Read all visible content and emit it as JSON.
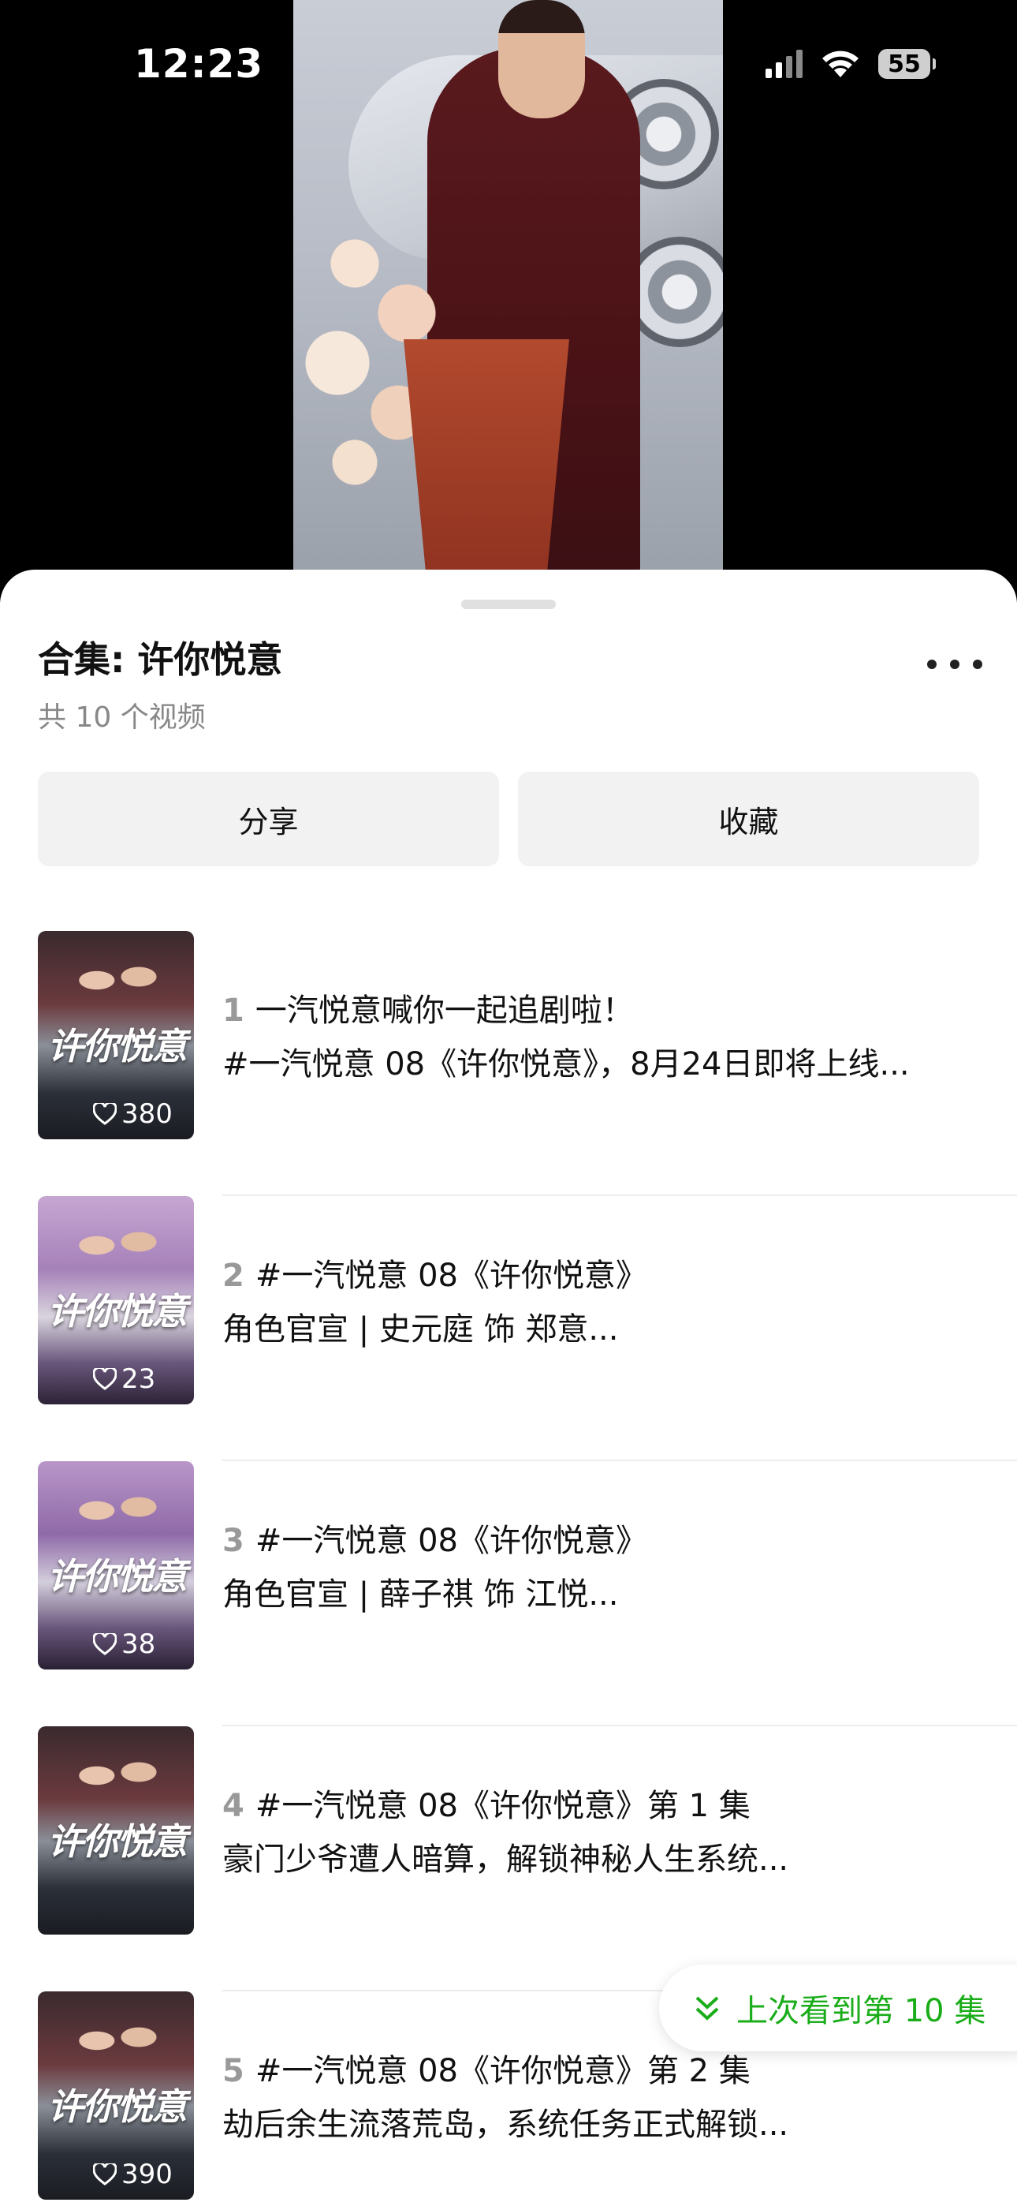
{
  "status_bar": {
    "time": "12:23",
    "battery": "55"
  },
  "sheet": {
    "title": "合集: 许你悦意",
    "subtitle": "共 10 个视频",
    "share_label": "分享",
    "favorite_label": "收藏",
    "more_icon": "more-dots-icon"
  },
  "episodes": [
    {
      "num": "1",
      "title": "一汽悦意喊你一起追剧啦！",
      "desc": "#一汽悦意 08《许你悦意》，8月24日即将上线...",
      "likes": "380",
      "thumb_text": "许你悦意"
    },
    {
      "num": "2",
      "title": "#一汽悦意 08《许你悦意》",
      "desc": "角色官宣 | 史元庭 饰 郑意...",
      "likes": "23",
      "thumb_text": "许你悦意"
    },
    {
      "num": "3",
      "title": "#一汽悦意 08《许你悦意》",
      "desc": "角色官宣 | 薛子祺 饰 江悦...",
      "likes": "38",
      "thumb_text": "许你悦意"
    },
    {
      "num": "4",
      "title": "#一汽悦意 08《许你悦意》第 1 集",
      "desc": "豪门少爷遭人暗算，解锁神秘人生系统...",
      "likes": "",
      "thumb_text": "许你悦意"
    },
    {
      "num": "5",
      "title": "#一汽悦意 08《许你悦意》第 2 集",
      "desc": "劫后余生流落荒岛，系统任务正式解锁...",
      "likes": "390",
      "thumb_text": "许你悦意"
    }
  ],
  "resume": {
    "label": "上次看到第 10 集",
    "color": "#1aad19"
  }
}
